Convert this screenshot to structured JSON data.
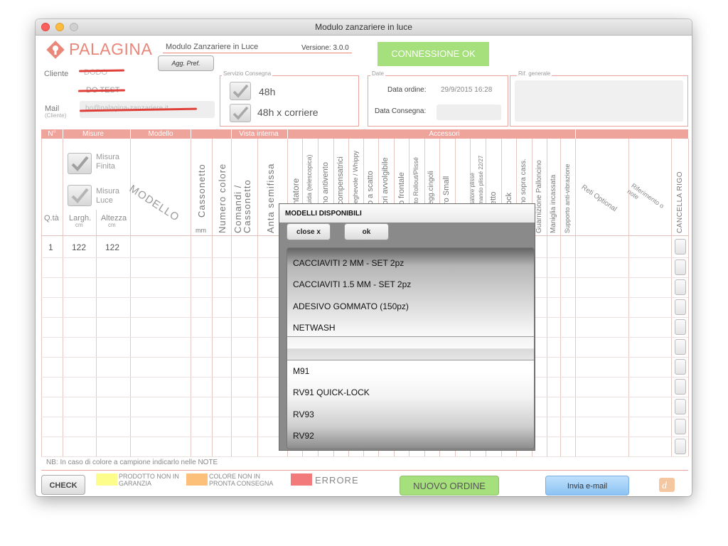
{
  "window": {
    "title": "Modulo zanzariere in luce"
  },
  "header": {
    "logo_text": "PALAGINA",
    "module_name": "Modulo Zanzariere in Luce",
    "version": "Versione: 3.0.0",
    "agg_pref_label": "Agg. Pref.",
    "connection_status": "CONNESSIONE OK",
    "colors": {
      "brand": "#e8877a",
      "connection_ok": "#a6e07c",
      "accent_band": "#eea39b"
    }
  },
  "client": {
    "cliente_label": "Cliente",
    "cliente_value": "DODO",
    "cliente_value2": "DO TEST",
    "mail_label": "Mail",
    "mail_sublabel": "(Cliente)",
    "mail_value": "bo@palagina-zanzariere.it"
  },
  "servizio": {
    "title": "Servizio Consegna",
    "opt_48h": "48h",
    "opt_48h_corriere": "48h x corriere"
  },
  "date": {
    "title": "Date",
    "data_ordine_label": "Data ordine:",
    "data_ordine_value": "29/9/2015 16:28",
    "data_consegna_label": "Data Consegna:"
  },
  "rif": {
    "title": "Rif. generale"
  },
  "table": {
    "bands": {
      "n": "N°",
      "misure": "Misure",
      "modello": "Modello",
      "vista_interna": "Vista interna",
      "accessori": "Accessori"
    },
    "misura_finita": "Misura Finita",
    "misura_luce": "Misura Luce",
    "qta": "Q.tà",
    "largh": "Largh.",
    "altezza": "Altezza",
    "cm": "cm",
    "mm": "mm",
    "modello_diag": "MODELLO",
    "vertical_headers": [
      "Cassonetto",
      "Numero colore",
      "Comandi / Cassonetto",
      "Anta semifissa",
      "ntatore",
      "uida (telescopica)",
      "no antivento",
      "compensatrici",
      "ieghevole / Whippy",
      "o a scatto",
      "ori avvolgibile",
      "o frontale",
      "tto Rollout/Plissé",
      "egg.cingoli",
      "ro Small",
      "satore plissé",
      "mando plissé 22/27",
      "etto",
      "ock",
      "no sopra cass.",
      "Guarnizione Palloncino",
      "Maniglia incassata",
      "Supporto anti-vibrazione",
      "CANCELLA RIGO"
    ],
    "reti_optional": "Reti Optional",
    "riferimento_note": "Riferimento o note",
    "rows": [
      {
        "qta": "1",
        "largh": "122",
        "altezza": "122"
      }
    ]
  },
  "modal": {
    "title": "MODELLI DISPONIBILI",
    "close_label": "close x",
    "ok_label": "ok",
    "items_above": [
      "CACCIAVITI 2 MM - SET 2pz",
      "CACCIAVITI 1.5 MM - SET 2pz",
      "ADESIVO GOMMATO (150pz)",
      "NETWASH"
    ],
    "items_below": [
      "M91",
      "RV91 QUICK-LOCK",
      "RV93",
      "RV92"
    ]
  },
  "footer": {
    "note": "NB: In caso di colore a campione indicarlo nelle NOTE",
    "check_label": "CHECK",
    "legend_prodotto": "PRODOTTO NON IN GARANZIA",
    "legend_colore": "COLORE NON IN PRONTA CONSEGNA",
    "legend_errore": "ERRORE",
    "nuovo_ordine": "NUOVO ORDINE",
    "invia_email": "Invia e-mail",
    "legend_colors": {
      "prodotto": "#fdfd8c",
      "colore": "#fcc07b",
      "errore": "#f27a7a"
    }
  }
}
